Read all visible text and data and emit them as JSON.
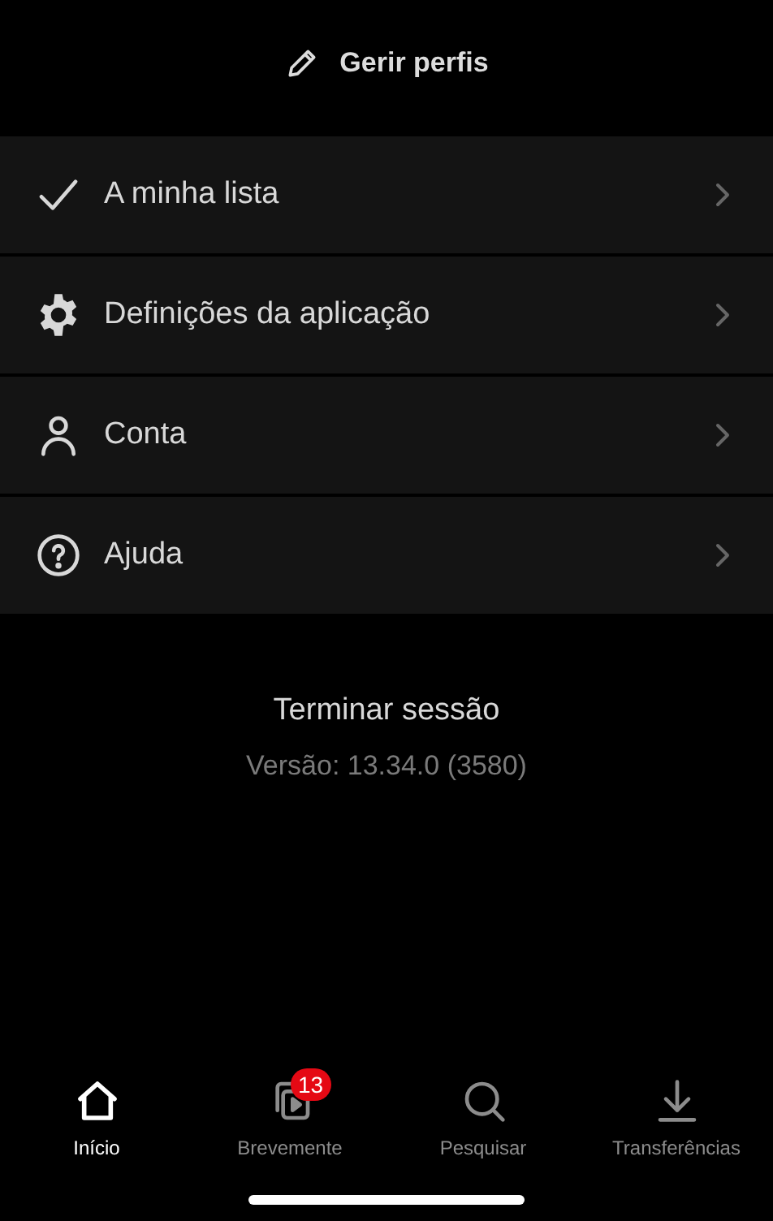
{
  "header": {
    "title": "Gerir perfis"
  },
  "menu": [
    {
      "kind": "check",
      "label": "A minha lista"
    },
    {
      "kind": "gear",
      "label": "Definições da aplicação"
    },
    {
      "kind": "person",
      "label": "Conta"
    },
    {
      "kind": "help",
      "label": "Ajuda"
    }
  ],
  "sign_out": "Terminar sessão",
  "version": "Versão: 13.34.0 (3580)",
  "tabs": [
    {
      "kind": "home",
      "label": "Início",
      "selected": true
    },
    {
      "kind": "coming",
      "label": "Brevemente",
      "selected": false,
      "badge": "13"
    },
    {
      "kind": "search",
      "label": "Pesquisar",
      "selected": false
    },
    {
      "kind": "download",
      "label": "Transferências",
      "selected": false
    }
  ]
}
